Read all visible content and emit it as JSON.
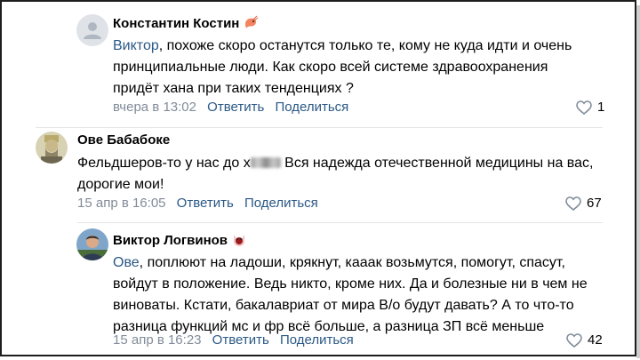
{
  "comments": [
    {
      "author": "Константин Костин",
      "badge_icon": "shrimp-emoji-icon",
      "mention": "Виктор",
      "text": ", похоже скоро останутся только те, кому не куда идти и очень принципиальные люди. Как скоро всей системе здравоохранения придёт хана при таких тенденциях ?",
      "time": "вчера в 13:02",
      "reply_label": "Ответить",
      "share_label": "Поделиться",
      "likes": "1"
    },
    {
      "author": "Ове Бабабоке",
      "text_before": "Фельдшеров-то у нас до х",
      "text_after": " Вся надежда отечественной медицины на вас, дорогие мои!",
      "time": "15 апр в 16:05",
      "reply_label": "Ответить",
      "share_label": "Поделиться",
      "likes": "67"
    },
    {
      "author": "Виктор Логвинов",
      "badge_icon": "cat-emoji-icon",
      "mention": "Ове",
      "text": ", поплюют на ладоши, крякнут, кааак возьмутся, помогут, спасут, войдут в положение. Ведь никто, кроме них. Да и болезные ни в чем не виноваты. Кстати, бакалавриат от мира В/о будут давать? А то что-то разница функций мс и фр всё больше, а разница ЗП всё меньше",
      "time": "15 апр в 16:23",
      "reply_label": "Ответить",
      "share_label": "Поделиться",
      "likes": "42"
    }
  ],
  "colors": {
    "link": "#2a5885",
    "meta": "#818c99",
    "divider": "#e5e5e5"
  }
}
